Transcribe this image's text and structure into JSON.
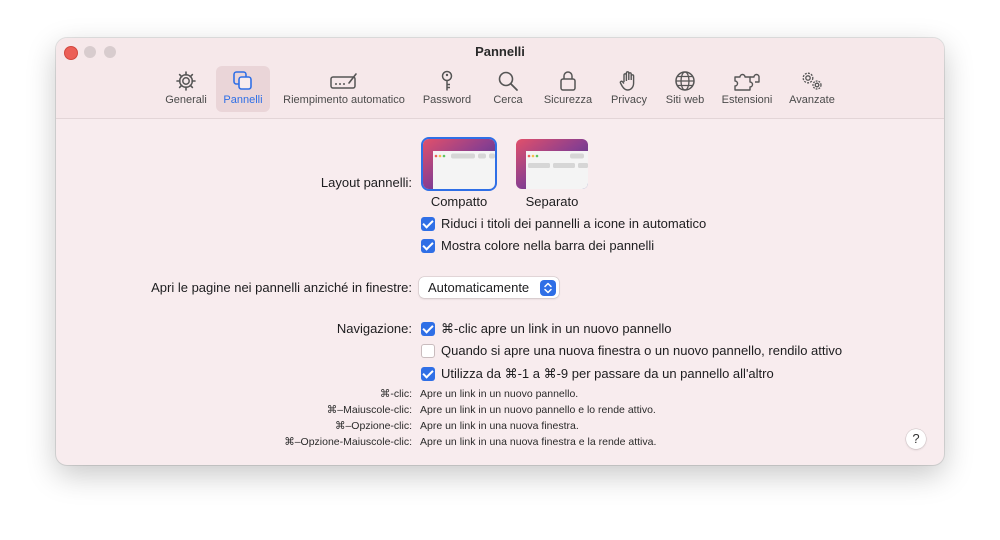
{
  "window": {
    "title": "Pannelli"
  },
  "toolbar": {
    "items": [
      {
        "label": "Generali",
        "icon": "gear-icon"
      },
      {
        "label": "Pannelli",
        "icon": "tabs-icon",
        "selected": true
      },
      {
        "label": "Riempimento automatico",
        "icon": "autofill-icon"
      },
      {
        "label": "Password",
        "icon": "key-icon"
      },
      {
        "label": "Cerca",
        "icon": "magnifier-icon"
      },
      {
        "label": "Sicurezza",
        "icon": "lock-icon"
      },
      {
        "label": "Privacy",
        "icon": "hand-icon"
      },
      {
        "label": "Siti web",
        "icon": "globe-icon"
      },
      {
        "label": "Estensioni",
        "icon": "puzzle-icon"
      },
      {
        "label": "Avanzate",
        "icon": "gears-icon"
      }
    ]
  },
  "layout": {
    "label": "Layout pannelli:",
    "options": [
      {
        "label": "Compatto",
        "selected": true
      },
      {
        "label": "Separato",
        "selected": false
      }
    ]
  },
  "options": {
    "compact_titles": {
      "label": "Riduci i titoli dei pannelli a icone in automatico",
      "checked": true
    },
    "show_color": {
      "label": "Mostra colore nella barra dei pannelli",
      "checked": true
    }
  },
  "open_pages": {
    "label": "Apri le pagine nei pannelli anziché in finestre:",
    "value": "Automaticamente"
  },
  "navigation": {
    "label": "Navigazione:",
    "items": [
      {
        "label": "⌘-clic apre un link in un nuovo pannello",
        "checked": true
      },
      {
        "label": "Quando si apre una nuova finestra o un nuovo pannello, rendilo attivo",
        "checked": false
      },
      {
        "label": "Utilizza da ⌘-1 a ⌘-9 per passare da un pannello all'altro",
        "checked": true
      }
    ]
  },
  "shortcuts": [
    {
      "key": "⌘-clic:",
      "desc": "Apre un link in un nuovo pannello."
    },
    {
      "key": "⌘–Maiuscole-clic:",
      "desc": "Apre un link in un nuovo pannello e lo rende attivo."
    },
    {
      "key": "⌘–Opzione-clic:",
      "desc": "Apre un link in una nuova finestra."
    },
    {
      "key": "⌘–Opzione-Maiuscole-clic:",
      "desc": "Apre un link in una nuova finestra e la rende attiva."
    }
  ],
  "help": {
    "label": "?"
  },
  "colors": {
    "accent": "#2f6fe6",
    "window_bg": "#f8ecee",
    "close": "#ec5f57"
  }
}
